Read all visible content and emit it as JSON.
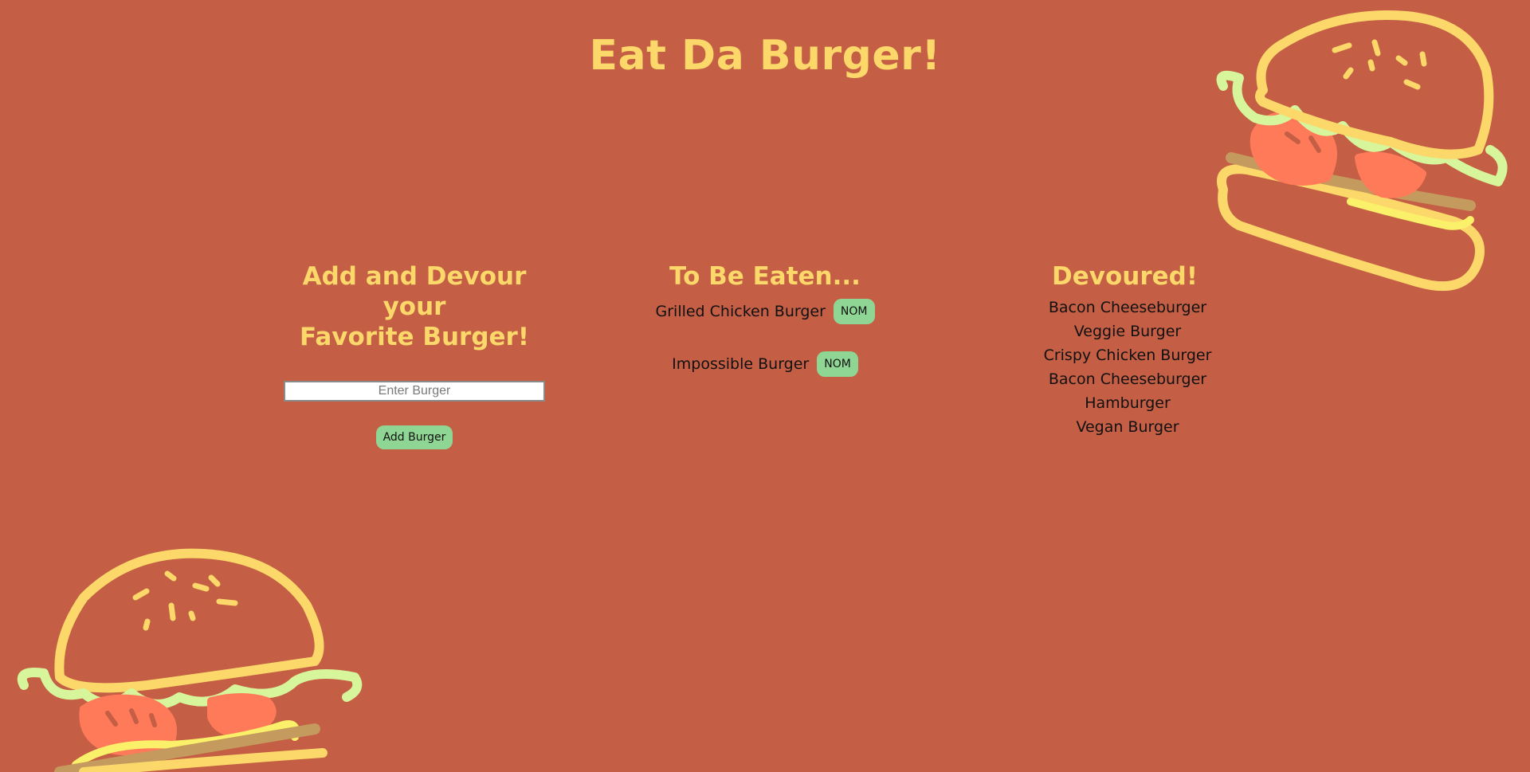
{
  "app": {
    "title": "Eat Da Burger!"
  },
  "add_section": {
    "heading_line1": "Add and Devour your",
    "heading_line2": "Favorite Burger!",
    "input_placeholder": "Enter Burger",
    "add_button_label": "Add Burger"
  },
  "to_be_eaten": {
    "heading": "To Be Eaten...",
    "items": [
      {
        "name": "Grilled Chicken Burger",
        "button_label": "NOM"
      },
      {
        "name": "Impossible Burger",
        "button_label": "NOM"
      }
    ]
  },
  "devoured": {
    "heading": "Devoured!",
    "items": [
      "Bacon Cheeseburger",
      "Veggie Burger",
      "Crispy Chicken Burger",
      "Bacon Cheeseburger",
      "Hamburger",
      "Vegan Burger"
    ]
  },
  "colors": {
    "background": "#c45e44",
    "heading": "#fcd76a",
    "button": "#8fd694",
    "bun": "#fcd76a",
    "lettuce": "#d7f59a",
    "tomato": "#ff7a59",
    "patty": "#c49a5e"
  },
  "decorations": {
    "top_right_icon": "burger-illustration",
    "bottom_left_icon": "burger-illustration"
  }
}
